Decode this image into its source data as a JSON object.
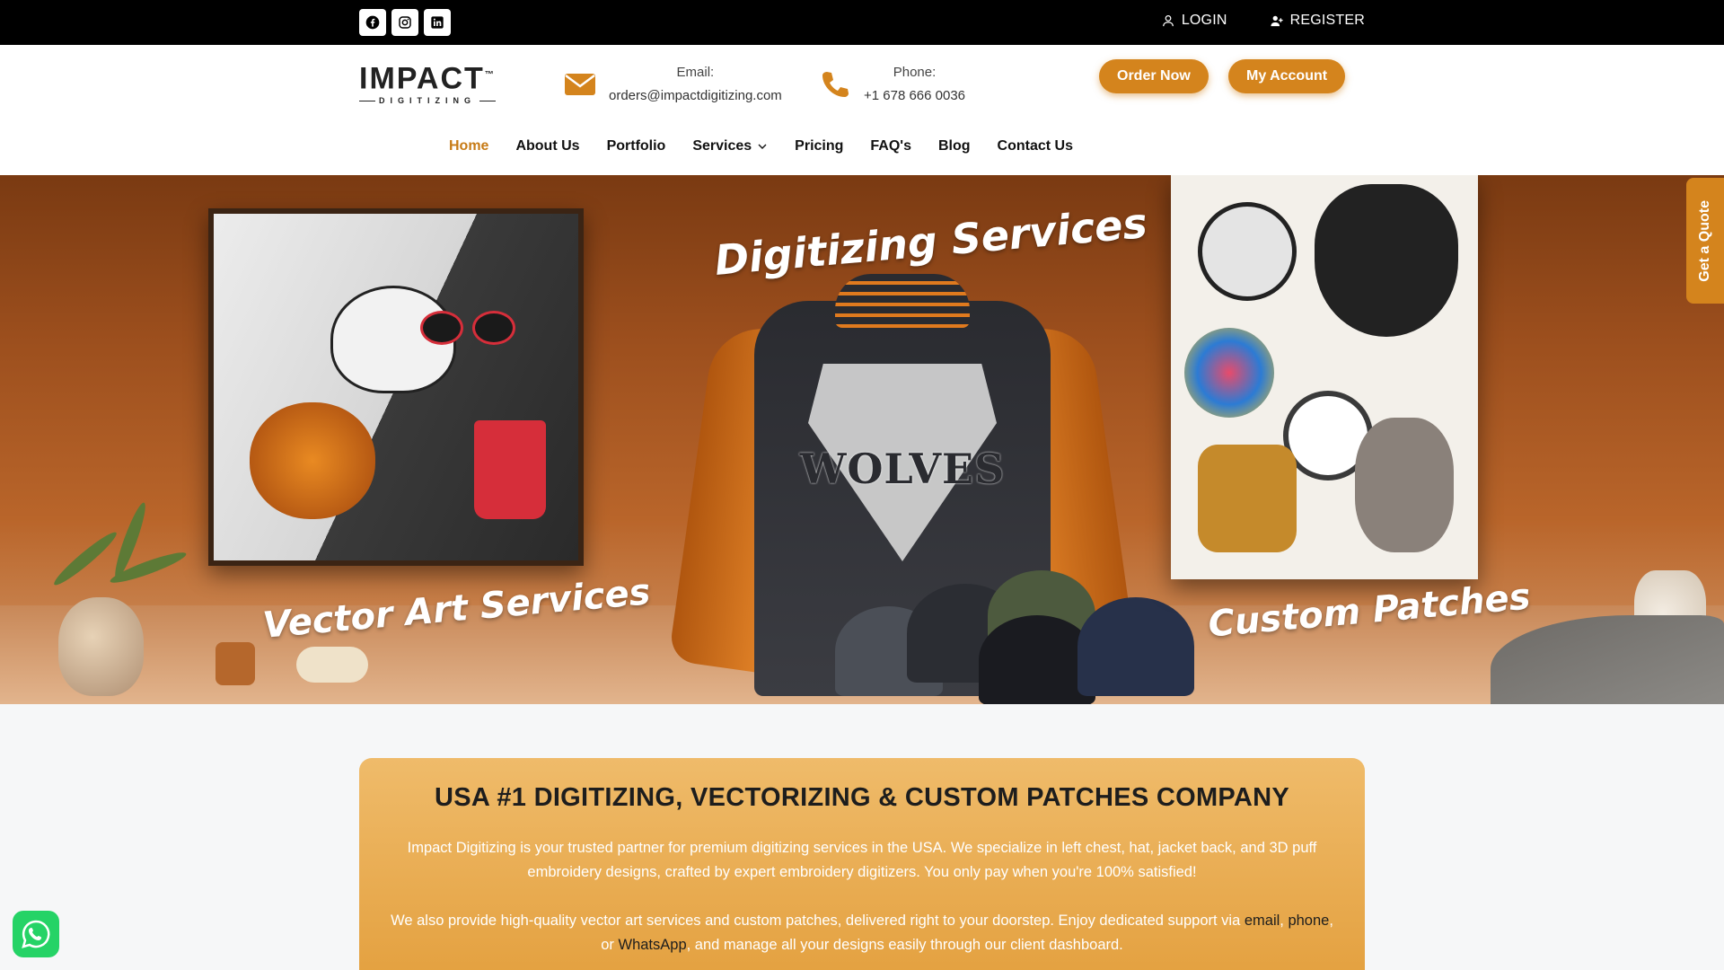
{
  "topbar": {
    "social": [
      {
        "icon": "facebook-icon"
      },
      {
        "icon": "instagram-icon"
      },
      {
        "icon": "linkedin-icon"
      }
    ],
    "login_label": "LOGIN",
    "register_label": "REGISTER"
  },
  "header": {
    "logo_main": "IMPACT",
    "logo_tm": "™",
    "logo_sub": "DIGITIZING",
    "email_label": "Email:",
    "email_value": "orders@impactdigitizing.com",
    "phone_label": "Phone:",
    "phone_value": "+1 678 666 0036",
    "order_now": "Order Now",
    "my_account": "My Account"
  },
  "nav": {
    "items": [
      "Home",
      "About Us",
      "Portfolio",
      "Services",
      "Pricing",
      "FAQ's",
      "Blog",
      "Contact Us"
    ],
    "active": "Home"
  },
  "hero": {
    "title_center": "Digitizing Services",
    "title_left": "Vector Art Services",
    "title_right": "Custom Patches",
    "jacket_text": "WOLVES",
    "quote_tab": "Get a Quote"
  },
  "content": {
    "heading": "USA #1 DIGITIZING, VECTORIZING & CUSTOM PATCHES COMPANY",
    "para1": "Impact Digitizing is your trusted partner for premium digitizing services in the USA. We specialize in left chest, hat, jacket back, and 3D puff embroidery designs, crafted by expert embroidery digitizers. You only pay when you're 100% satisfied!",
    "para2_before": "We also provide high-quality vector art services and custom patches, delivered right to your doorstep. Enjoy dedicated support via ",
    "link_email": "email",
    "sep1": ", ",
    "link_phone": "phone",
    "sep2": ", or ",
    "link_whatsapp": "WhatsApp",
    "para2_after": ", and manage all your designs easily through our client dashboard."
  },
  "colors": {
    "accent": "#d4841d",
    "topbar": "#000000",
    "whatsapp": "#25d366"
  }
}
